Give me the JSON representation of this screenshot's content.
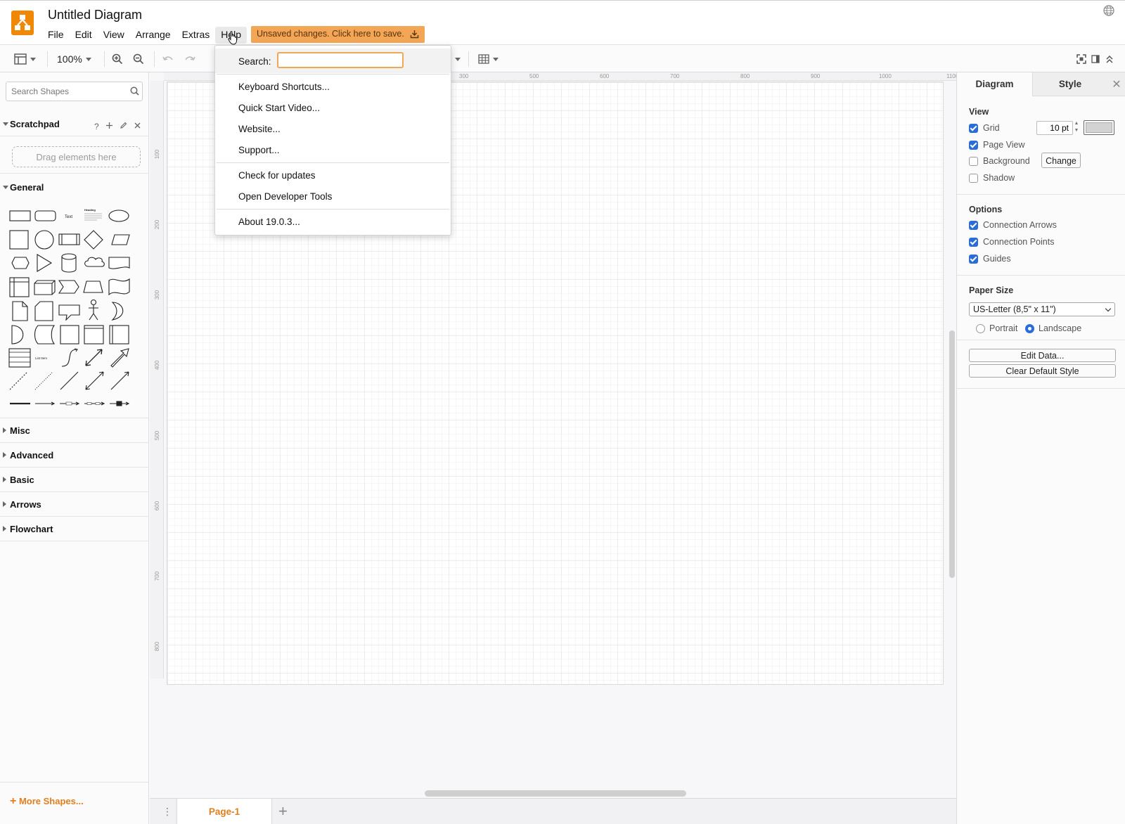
{
  "app": {
    "title": "Untitled Diagram",
    "unsaved_notice": "Unsaved changes. Click here to save.",
    "accent_color": "#f08705"
  },
  "menubar": {
    "items": [
      "File",
      "Edit",
      "View",
      "Arrange",
      "Extras",
      "Help"
    ],
    "active": "Help"
  },
  "toolbar": {
    "zoom": "100%"
  },
  "help_menu": {
    "search_label": "Search:",
    "search_value": "",
    "groups": [
      [
        "Keyboard Shortcuts...",
        "Quick Start Video...",
        "Website...",
        "Support..."
      ],
      [
        "Check for updates",
        "Open Developer Tools"
      ],
      [
        "About 19.0.3..."
      ]
    ]
  },
  "sidebar": {
    "search_placeholder": "Search Shapes",
    "scratchpad": {
      "title": "Scratchpad",
      "help": "?",
      "drop_hint": "Drag elements here"
    },
    "general_title": "General",
    "shape_text_labels": {
      "text": "Text",
      "heading": "Heading",
      "list_item": "List Item"
    },
    "collapsed_sections": [
      "Misc",
      "Advanced",
      "Basic",
      "Arrows",
      "Flowchart"
    ],
    "more_shapes": "More Shapes..."
  },
  "rulers": {
    "top": [
      "300",
      "500",
      "600",
      "700",
      "800",
      "900",
      "1000",
      "1100"
    ],
    "left": [
      "100",
      "200",
      "300",
      "400",
      "500",
      "600",
      "700",
      "800"
    ]
  },
  "pages": {
    "tabs": [
      "Page-1"
    ]
  },
  "format_panel": {
    "tabs": [
      "Diagram",
      "Style"
    ],
    "active_tab": "Diagram",
    "view": {
      "title": "View",
      "grid": {
        "label": "Grid",
        "checked": true,
        "size": "10 pt"
      },
      "page_view": {
        "label": "Page View",
        "checked": true
      },
      "background": {
        "label": "Background",
        "checked": false,
        "button": "Change"
      },
      "shadow": {
        "label": "Shadow",
        "checked": false
      }
    },
    "options": {
      "title": "Options",
      "connection_arrows": {
        "label": "Connection Arrows",
        "checked": true
      },
      "connection_points": {
        "label": "Connection Points",
        "checked": true
      },
      "guides": {
        "label": "Guides",
        "checked": true
      }
    },
    "paper": {
      "title": "Paper Size",
      "selected": "US-Letter (8,5\" x 11\")",
      "portrait": "Portrait",
      "landscape": "Landscape",
      "orientation": "Landscape"
    },
    "buttons": {
      "edit_data": "Edit Data...",
      "clear_default_style": "Clear Default Style"
    }
  }
}
